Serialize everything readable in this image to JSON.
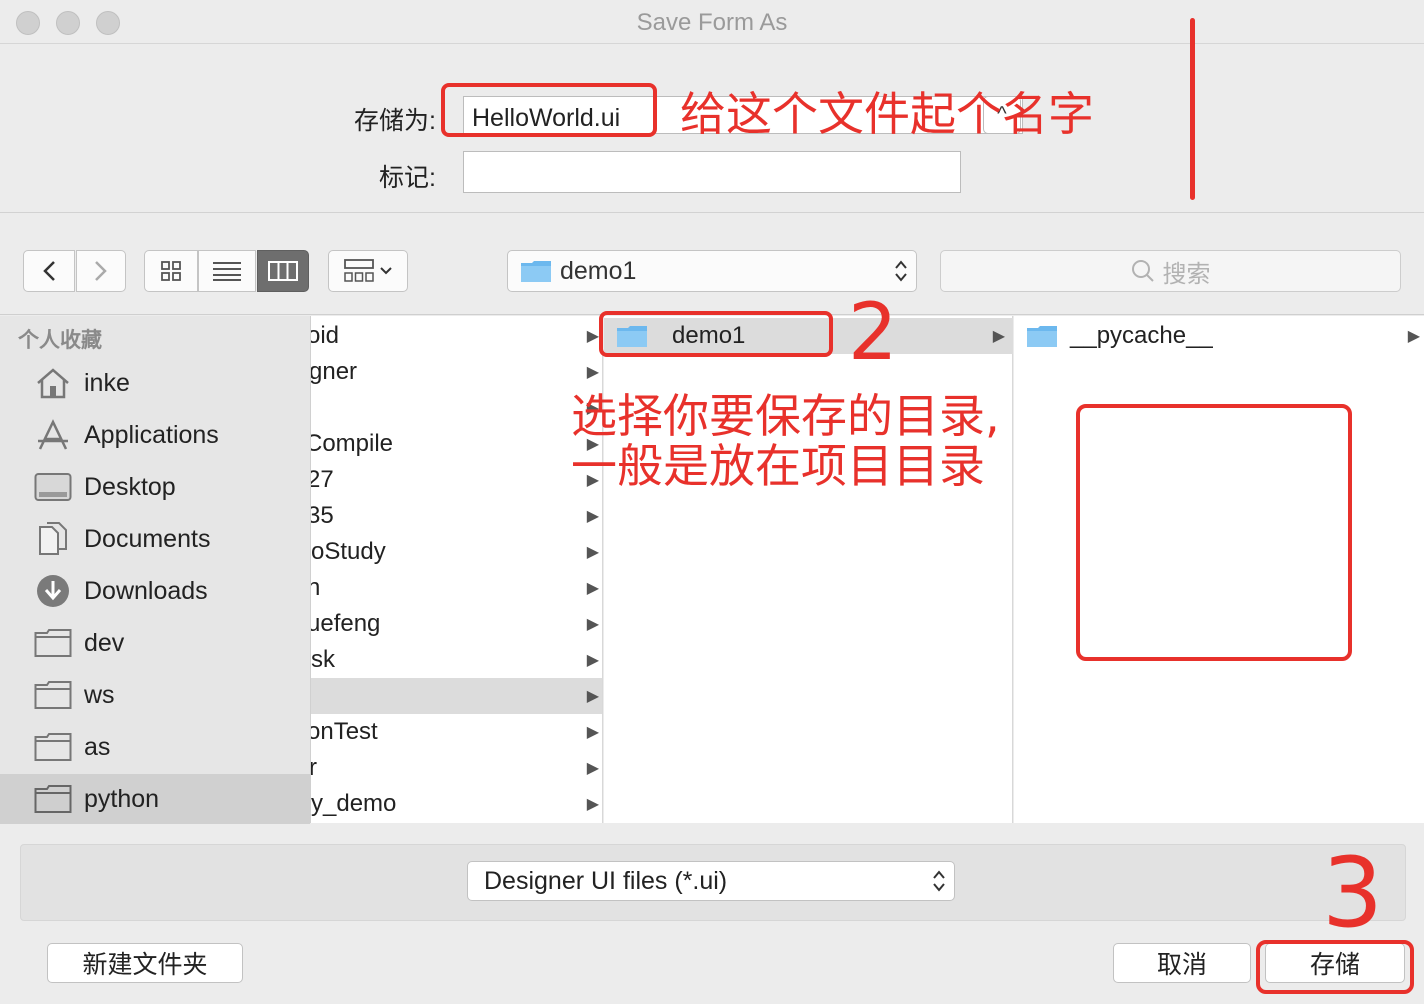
{
  "window": {
    "title": "Save Form As"
  },
  "form": {
    "save_as_label": "存储为:",
    "filename_value": "HelloWorld.ui",
    "tags_label": "标记:",
    "tags_value": ""
  },
  "toolbar": {
    "back_icon": "chevron-left-icon",
    "forward_icon": "chevron-right-icon",
    "path_value": "demo1",
    "search_placeholder": "搜索"
  },
  "sidebar": {
    "header": "个人收藏",
    "items": [
      {
        "label": "inke",
        "icon": "home-icon"
      },
      {
        "label": "Applications",
        "icon": "applications-icon"
      },
      {
        "label": "Desktop",
        "icon": "desktop-icon"
      },
      {
        "label": "Documents",
        "icon": "documents-icon"
      },
      {
        "label": "Downloads",
        "icon": "downloads-icon"
      },
      {
        "label": "dev",
        "icon": "folder-icon"
      },
      {
        "label": "ws",
        "icon": "folder-icon"
      },
      {
        "label": "as",
        "icon": "folder-icon"
      },
      {
        "label": "python",
        "icon": "folder-icon",
        "selected": true
      }
    ]
  },
  "columns": {
    "col1": [
      "oid",
      "gner",
      "",
      "Compile",
      "27",
      "35",
      "oStudy",
      "n",
      "uefeng",
      "sk",
      "",
      "onTest",
      "r",
      "y_demo"
    ],
    "col2": [
      "demo1"
    ],
    "col3": [
      "__pycache__"
    ]
  },
  "bottom": {
    "format_value": "Designer UI files (*.ui)",
    "new_folder_label": "新建文件夹",
    "cancel_label": "取消",
    "save_label": "存储"
  },
  "annotations": {
    "name_note": "给这个文件起个名字",
    "dir_note_line1": "选择你要保存的目录,",
    "dir_note_line2": "一般是放在项目目录",
    "step1": "1",
    "step2": "2",
    "step3": "3"
  },
  "colors": {
    "annotation": "#e8312b",
    "folder": "#6cb8ee",
    "selected_view": "#6e6e6e"
  }
}
